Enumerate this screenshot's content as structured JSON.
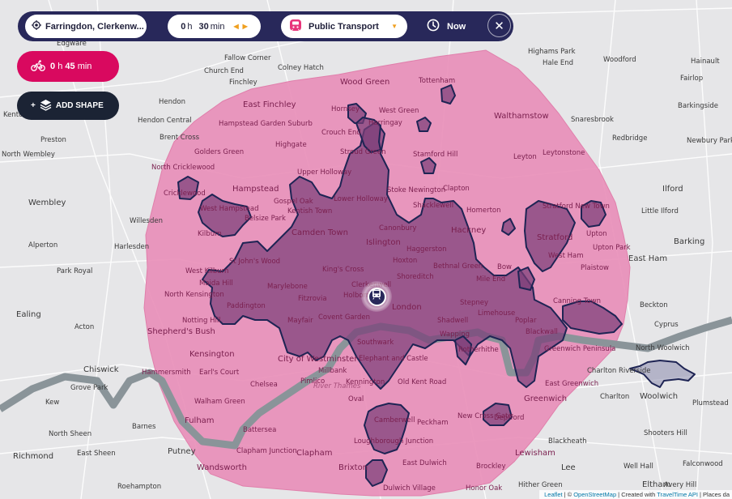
{
  "toolbar": {
    "origin": {
      "icon": "location-target-icon",
      "label": "Farringdon, Clerkenw..."
    },
    "duration": {
      "hours": "0",
      "hours_unit": "h",
      "minutes": "30",
      "minutes_unit": "min",
      "decrease_glyph": "◀",
      "increase_glyph": "▶"
    },
    "mode": {
      "icon": "train-icon",
      "label": "Public Transport",
      "caret": "▼"
    },
    "time": {
      "icon": "clock-icon",
      "label": "Now"
    },
    "close": {
      "icon": "close-icon",
      "glyph": "✕"
    }
  },
  "secondary_shape": {
    "icon": "bicycle-icon",
    "hours": "0",
    "hours_unit": "h",
    "minutes": "45",
    "minutes_unit": "min",
    "color": "#d9095f"
  },
  "add_shape": {
    "prefix": "+",
    "icon": "layers-icon",
    "label": "ADD SHAPE"
  },
  "colors": {
    "toolbar_bg": "#28285a",
    "cycling_shape_fill": "#e88fb8",
    "transit_shape_fill": "#8a4f85",
    "transit_shape_stroke": "#1e2454",
    "water": "#8a9499",
    "land": "#e6e6e8"
  },
  "marker": {
    "icon": "train-icon",
    "label": "Origin"
  },
  "attribution": {
    "leaflet": "Leaflet",
    "sep1": "| ©",
    "osm": "OpenStreetMap",
    "sep2": "| Created with",
    "traveltime": "TravelTime API",
    "sep3": "| Places da"
  },
  "map_labels": {
    "outside": [
      "Edgware",
      "Hendon",
      "Hendon Central",
      "Brent Cross",
      "Preston",
      "Wembley",
      "North Wembley",
      "Kenton",
      "Alperton",
      "Harlesden",
      "Willesden",
      "Park Royal",
      "Ealing",
      "Acton",
      "Chiswick",
      "Grove Park",
      "Kew",
      "North Sheen",
      "Barnes",
      "Richmond",
      "East Sheen",
      "Putney",
      "Roehampton",
      "Highams Park",
      "Hale End",
      "Woodford",
      "Hainault",
      "Fairlop",
      "Barkingside",
      "Snaresbrook",
      "Redbridge",
      "Newbury Park",
      "Ilford",
      "Little Ilford",
      "Barking",
      "East Ham",
      "Beckton",
      "Cyprus",
      "North Woolwich",
      "Charlton Riverside",
      "Charlton",
      "Woolwich",
      "Plumstead",
      "Shooters Hill",
      "Blackheath",
      "Lee",
      "Well Hall",
      "Falconwood",
      "Eltham",
      "Avery Hill",
      "Hither Green",
      "Fallow Corner",
      "Church End",
      "Finchley",
      "Colney Hatch"
    ],
    "inside": [
      "Wood Green",
      "Tottenham",
      "East Finchley",
      "Hampstead Garden Suburb",
      "Golders Green",
      "North Cricklewood",
      "Cricklewood",
      "Hornsey",
      "West Green",
      "Harringay",
      "Crouch End",
      "Highgate",
      "Stroud Green",
      "Stamford Hill",
      "Walthamstow",
      "Leyton",
      "Leytonstone",
      "Upper Holloway",
      "Hampstead",
      "West Hampstead",
      "Belsize Park",
      "Gospel Oak",
      "Kentish Town",
      "Lower Holloway",
      "Stoke Newington",
      "Clapton",
      "Shacklewell",
      "Homerton",
      "Kilburn",
      "Camden Town",
      "Islington",
      "Canonbury",
      "Hackney",
      "Stratford New Town",
      "Stratford",
      "Upton",
      "Upton Park",
      "West Ham",
      "Plaistow",
      "West Kilburn",
      "St John's Wood",
      "King's Cross",
      "Haggerston",
      "Hoxton",
      "Bethnal Green",
      "Bow",
      "Mile End",
      "North Kensington",
      "Maida Hill",
      "Paddington",
      "Marylebone",
      "Fitzrovia",
      "Clerkenwell",
      "Holborn",
      "Shoreditch",
      "London",
      "Stepney",
      "Limehouse",
      "Poplar",
      "Canning Town",
      "Notting Hill",
      "Shepherd's Bush",
      "Mayfair",
      "Covent Garden",
      "Shadwell",
      "Wapping",
      "Rotherhithe",
      "Blackwall",
      "Greenwich Peninsula",
      "Kensington",
      "City of Westminster",
      "Southwark",
      "Elephant and Castle",
      "Millbank",
      "Hammersmith",
      "Earl's Court",
      "Chelsea",
      "Pimlico",
      "Kennington",
      "Old Kent Road",
      "Oval",
      "East Greenwich",
      "Greenwich",
      "Walham Green",
      "Fulham",
      "Battersea",
      "Camberwell",
      "Peckham",
      "New Cross Gate",
      "Deptford",
      "Loughborough Junction",
      "Clapham Junction",
      "Clapham",
      "Brixton",
      "East Dulwich",
      "Brockley",
      "Lewisham",
      "Wandsworth",
      "Dulwich Village",
      "Honor Oak",
      "River Thames"
    ]
  }
}
